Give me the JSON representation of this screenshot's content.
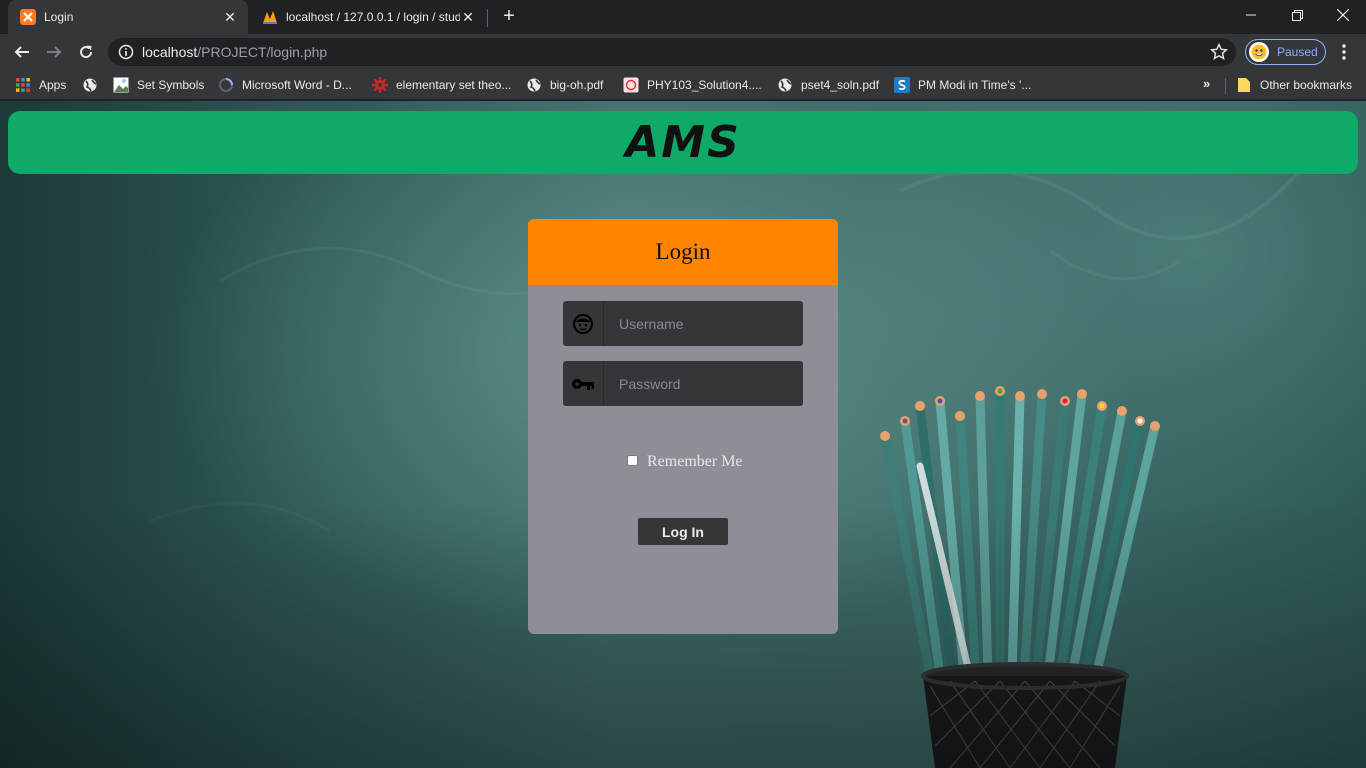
{
  "browser": {
    "tabs": [
      {
        "title": "Login",
        "active": true
      },
      {
        "title": "localhost / 127.0.0.1 / login / stud",
        "active": false
      }
    ],
    "address": {
      "host": "localhost",
      "path": "/PROJECT/login.php"
    },
    "profile": {
      "label": "Paused"
    },
    "bookmarks": [
      {
        "label": "Apps",
        "icon": "apps-grid-icon"
      },
      {
        "label": "",
        "icon": "globe-icon"
      },
      {
        "label": "Set Symbols",
        "icon": "image-icon"
      },
      {
        "label": "Microsoft Word - D...",
        "icon": "loading-icon"
      },
      {
        "label": "elementary set theo...",
        "icon": "gear-red-icon"
      },
      {
        "label": "big-oh.pdf",
        "icon": "globe-icon"
      },
      {
        "label": "PHY103_Solution4....",
        "icon": "pdf-icon"
      },
      {
        "label": "pset4_soln.pdf",
        "icon": "globe-icon"
      },
      {
        "label": "PM Modi in Time's '...",
        "icon": "scribd-icon"
      }
    ],
    "other_bookmarks": "Other bookmarks"
  },
  "page": {
    "brand": "AMS",
    "login": {
      "heading": "Login",
      "username_placeholder": "Username",
      "password_placeholder": "Password",
      "remember_label": "Remember Me",
      "submit_label": "Log In"
    }
  },
  "colors": {
    "banner": "#0fa968",
    "card_header": "#ff8400",
    "card_body": "#8e8e96",
    "field_bg": "#35363a"
  }
}
